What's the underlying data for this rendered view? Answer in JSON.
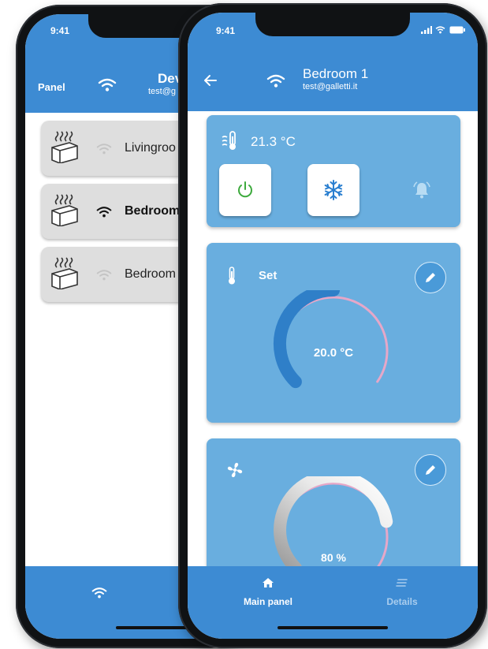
{
  "back_phone": {
    "status_time": "9:41",
    "header_left": "Panel",
    "header_title": "Dev",
    "header_subtitle": "test@g",
    "devices": [
      {
        "label": "Livingroo",
        "bold": false,
        "signal": "weak"
      },
      {
        "label": "Bedroom",
        "bold": true,
        "signal": "strong"
      },
      {
        "label": "Bedroom",
        "bold": false,
        "signal": "weak"
      }
    ]
  },
  "front_phone": {
    "status_time": "9:41",
    "title": "Bedroom 1",
    "subtitle": "test@galletti.it",
    "current_temp": "21.3 °C",
    "set_label": "Set",
    "set_temp": "20.0 °C",
    "set_level": 0.5,
    "fan_value": "80 %",
    "fan_level": 0.8,
    "tabs": [
      {
        "label": "Main panel",
        "active": true
      },
      {
        "label": "Details",
        "active": false
      }
    ]
  },
  "colors": {
    "header_blue": "#3d8bd3",
    "card_blue": "#69aedf",
    "power_green": "#3daa3d",
    "snow_blue": "#2a7fd0"
  },
  "icons": [
    "wifi-icon",
    "back-arrow-icon",
    "heater-icon",
    "thermometer-icon",
    "power-icon",
    "snowflake-icon",
    "bell-icon",
    "pencil-icon",
    "fan-icon",
    "home-icon",
    "details-icon"
  ]
}
